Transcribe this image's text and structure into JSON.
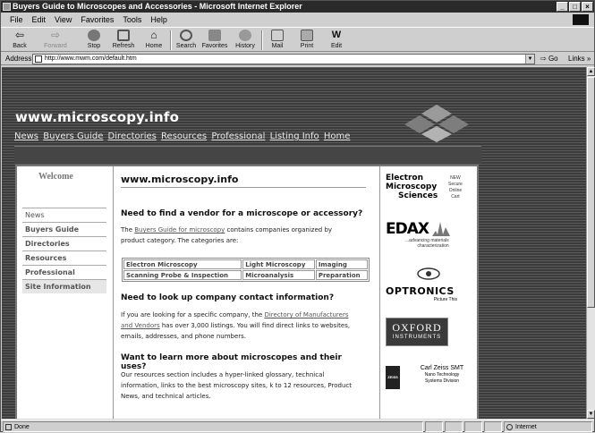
{
  "window": {
    "title": "Buyers Guide to Microscopes and Accessories - Microsoft Internet Explorer"
  },
  "menu": [
    "File",
    "Edit",
    "View",
    "Favorites",
    "Tools",
    "Help"
  ],
  "toolbar": {
    "back": "Back",
    "forward": "Forward",
    "stop": "Stop",
    "refresh": "Refresh",
    "home": "Home",
    "search": "Search",
    "favorites": "Favorites",
    "history": "History",
    "mail": "Mail",
    "print": "Print",
    "edit": "Edit"
  },
  "address": {
    "label": "Address",
    "url": "http://www.mwm.com/default.htm",
    "go": "Go",
    "links": "Links »"
  },
  "site": {
    "title": "www.microscopy.info",
    "nav": [
      "News",
      "Buyers Guide",
      "Directories",
      "Resources",
      "Professional",
      "Listing Info",
      "Home"
    ]
  },
  "sidebar": {
    "welcome": "Welcome",
    "items": [
      "News",
      "Buyers Guide",
      "Directories",
      "Resources",
      "Professional",
      "Site Information"
    ]
  },
  "main": {
    "title": "www.microscopy.info",
    "h1": "Need to find a vendor for a microscope or accessory?",
    "p1_pre": "The ",
    "p1_link": "Buyers Guide for microscopy",
    "p1_post": " contains companies organized by product category. The categories are:",
    "categories": [
      [
        "Electron Microscopy",
        "Light Microscopy",
        "Imaging"
      ],
      [
        "Scanning Probe & Inspection",
        "Microanalysis",
        "Preparation"
      ]
    ],
    "h2": "Need to look up company contact information?",
    "p2_pre": "If you are looking for a specific company, the ",
    "p2_link": "Directory of Manufacturers and Vendors",
    "p2_post": " has over 3,000 listings. You will find direct links to websites, emails, addresses, and phone numbers.",
    "h3": "Want to learn more about microscopes and their uses?",
    "p3": "Our resources section includes a hyper-linked glossary, technical information, links to the best microscopy sites, k to 12 resources, Product News, and technical articles."
  },
  "sponsors": {
    "ems": {
      "line1": "Electron",
      "line2": "Microscopy",
      "line3": "Sciences",
      "badge1": "NEW",
      "badge2": "Secure",
      "badge3": "Online",
      "badge4": "Cart"
    },
    "edax": {
      "name": "EDAX",
      "tag1": "...advancing materials",
      "tag2": "characterization"
    },
    "optronics": {
      "name": "OPTRONICS",
      "tag": "Picture This"
    },
    "oxford": {
      "line1": "OXFORD",
      "line2": "INSTRUMENTS"
    },
    "zeiss": {
      "mark": "ZEISS",
      "line1": "Carl Zeiss SMT",
      "line2": "Nano Technology",
      "line3": "Systems Division"
    }
  },
  "status": {
    "left": "Done",
    "zone": "Internet"
  }
}
